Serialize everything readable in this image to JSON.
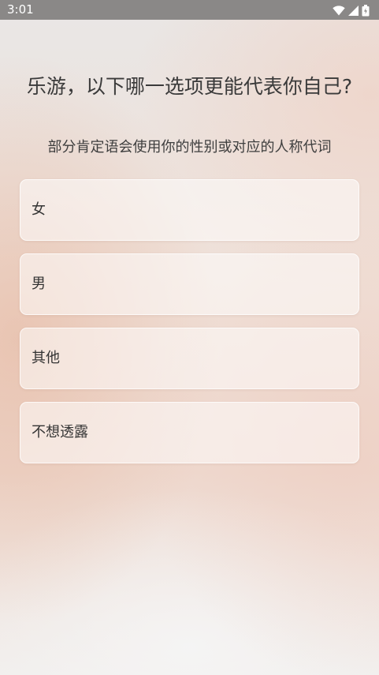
{
  "status_bar": {
    "time": "3:01",
    "icons": [
      "wifi-icon",
      "cellular-signal-icon",
      "battery-icon"
    ],
    "color": "#ffffff",
    "background": "#8a8887"
  },
  "question": {
    "title": "乐游，以下哪一选项更能代表你自己?",
    "subtitle": "部分肯定语会使用你的性别或对应的人称代词"
  },
  "options": [
    {
      "label": "女"
    },
    {
      "label": "男"
    },
    {
      "label": "其他"
    },
    {
      "label": "不想透露"
    }
  ]
}
